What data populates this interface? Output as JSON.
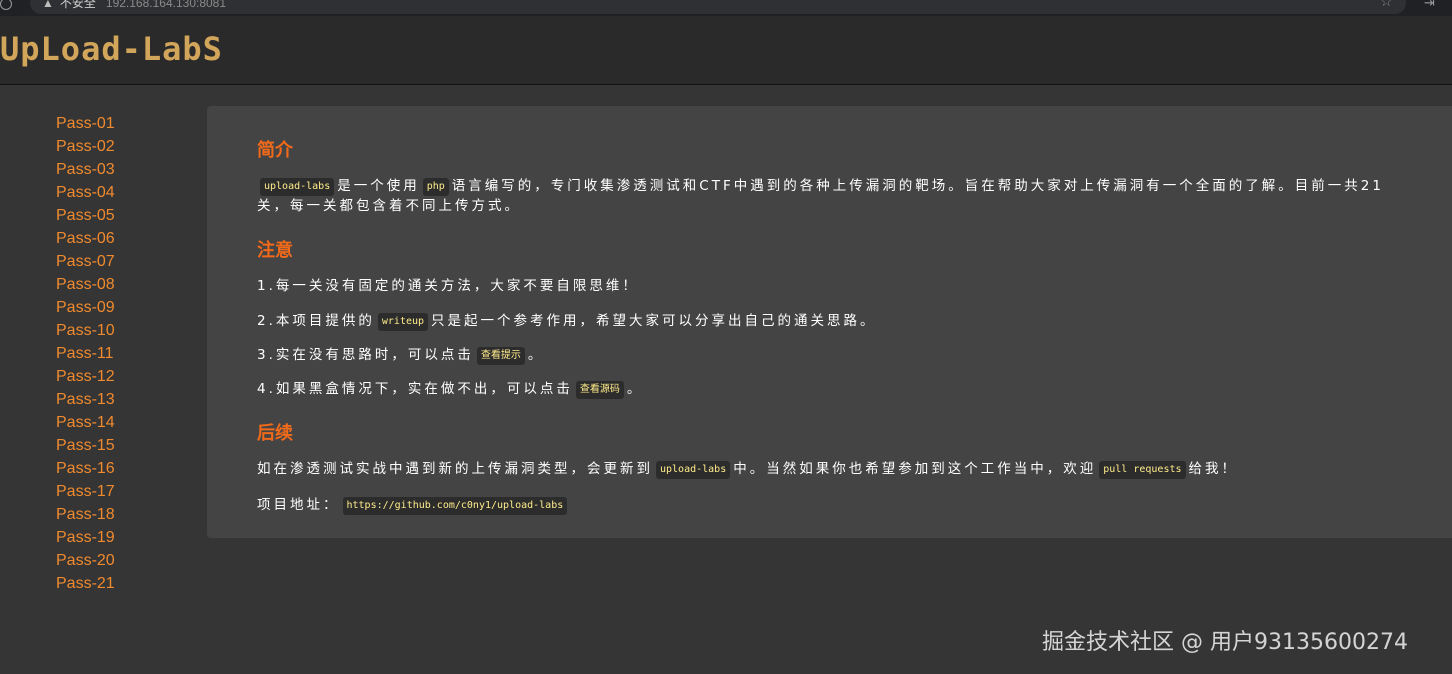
{
  "browser": {
    "security_label": "不安全",
    "url": "192.168.164.130:8081"
  },
  "header": {
    "logo_text": "UpLoad-LabS"
  },
  "sidebar": {
    "items": [
      "Pass-01",
      "Pass-02",
      "Pass-03",
      "Pass-04",
      "Pass-05",
      "Pass-06",
      "Pass-07",
      "Pass-08",
      "Pass-09",
      "Pass-10",
      "Pass-11",
      "Pass-12",
      "Pass-13",
      "Pass-14",
      "Pass-15",
      "Pass-16",
      "Pass-17",
      "Pass-18",
      "Pass-19",
      "Pass-20",
      "Pass-21"
    ]
  },
  "intro": {
    "title": "简介",
    "code_name": "upload-labs",
    "t1": "是一个使用",
    "code_php": "php",
    "t2": "语言编写的，专门收集渗透测试和CTF中遇到的各种上传漏洞的靶场。旨在帮助大家对上传漏洞有一个全面的了解。目前一共21关，每一关都包含着不同上传方式。"
  },
  "notice": {
    "title": "注意",
    "item1": "1.每一关没有固定的通关方法，大家不要自限思维！",
    "item2_a": "2.本项目提供的",
    "item2_code": "writeup",
    "item2_b": "只是起一个参考作用，希望大家可以分享出自己的通关思路。",
    "item3_a": "3.实在没有思路时，可以点击",
    "item3_code": "查看提示",
    "item3_b": "。",
    "item4_a": "4.如果黑盒情况下，实在做不出，可以点击",
    "item4_code": "查看源码",
    "item4_b": "。"
  },
  "followup": {
    "title": "后续",
    "t1": "如在渗透测试实战中遇到新的上传漏洞类型，会更新到",
    "code_name": "upload-labs",
    "t2": "中。当然如果你也希望参加到这个工作当中，欢迎",
    "code_pr": "pull requests",
    "t3": "给我！",
    "addr_label": "项目地址：",
    "addr_url": "https://github.com/c0ny1/upload-labs"
  },
  "watermark": "掘金技术社区 @ 用户93135600274"
}
